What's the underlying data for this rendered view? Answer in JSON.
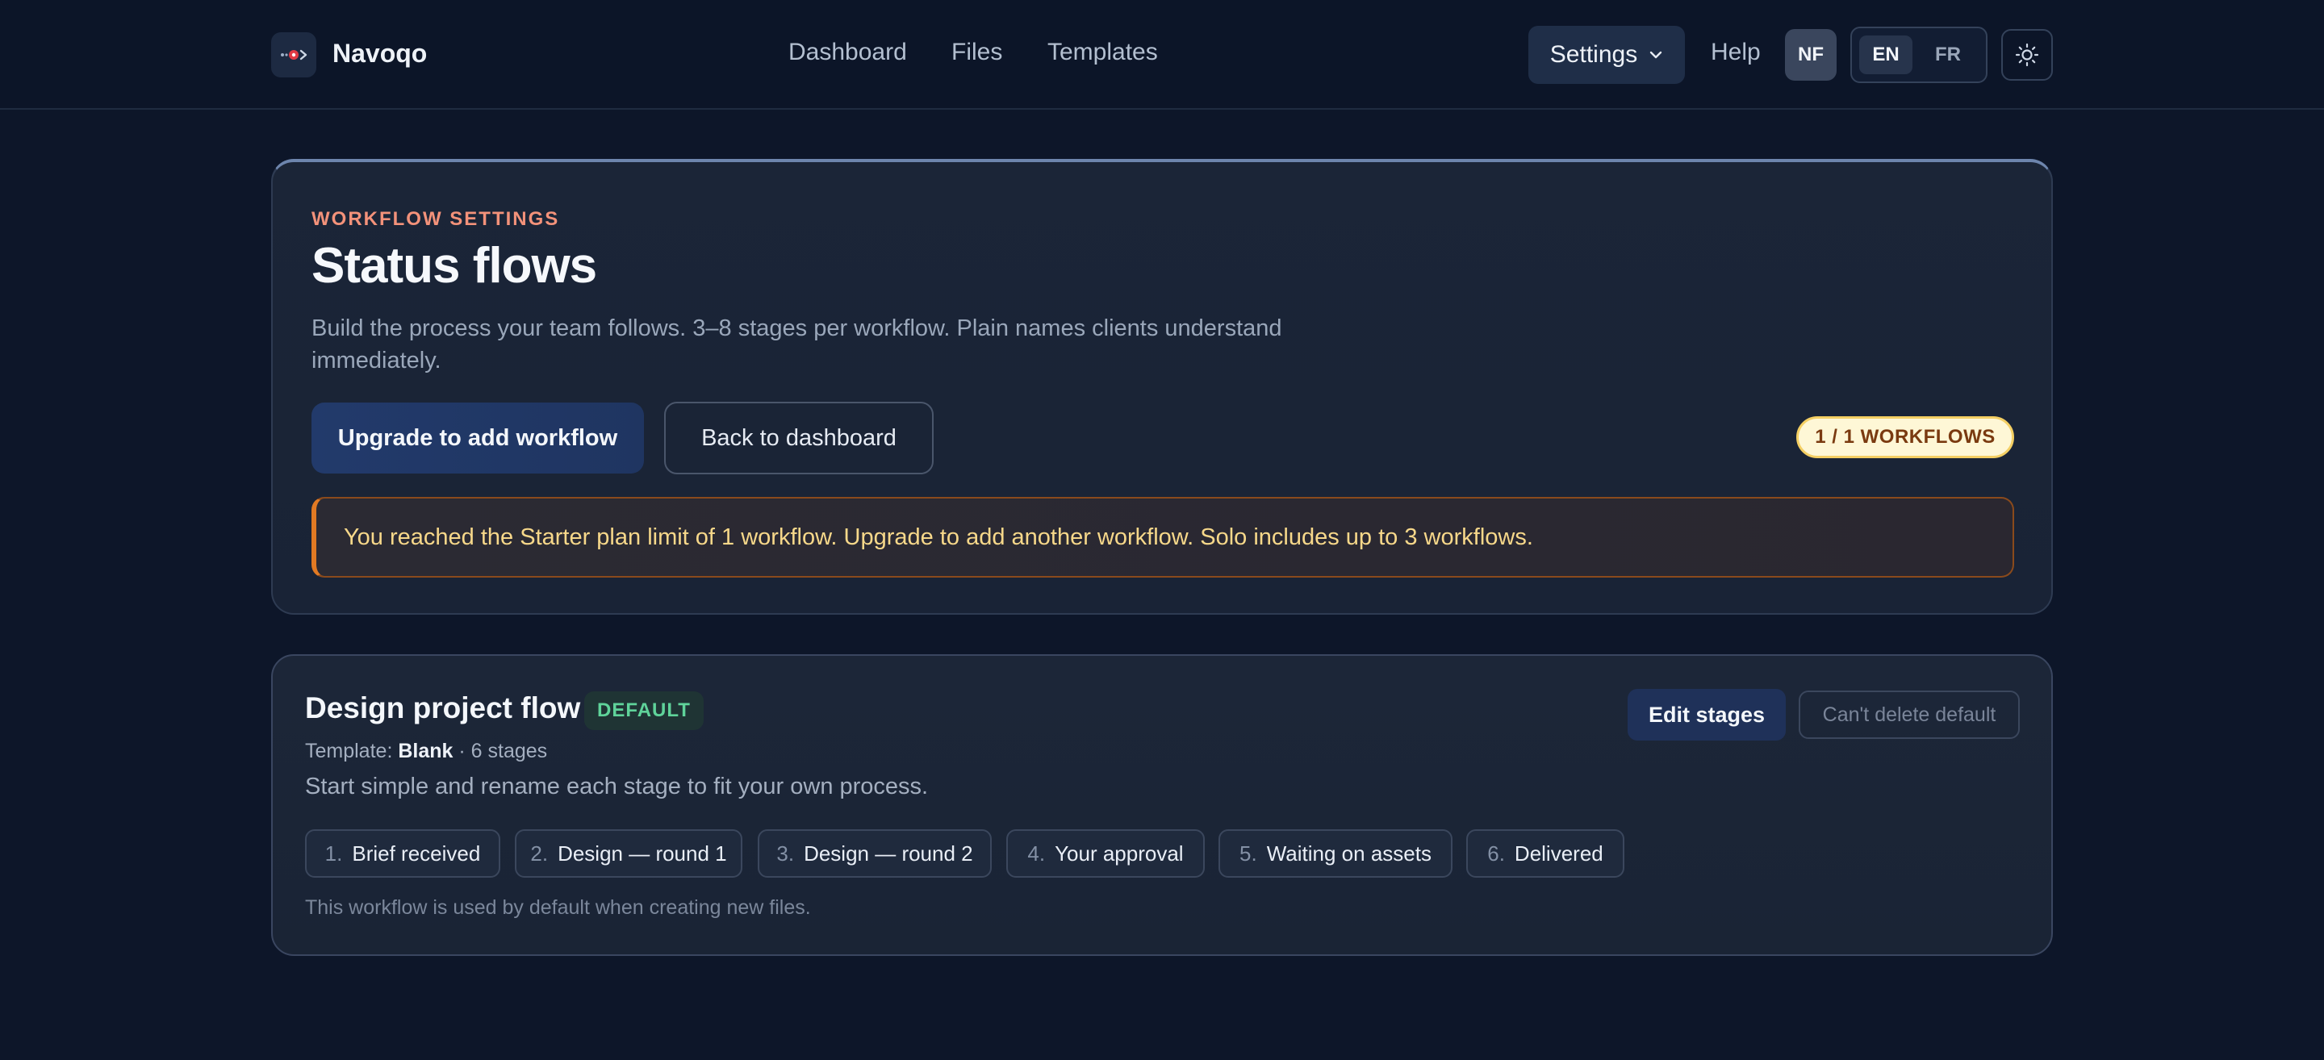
{
  "header": {
    "brand": "Navoqo",
    "nav": [
      "Dashboard",
      "Files",
      "Templates"
    ],
    "settings_label": "Settings",
    "help_label": "Help",
    "avatar_initials": "NF",
    "languages": [
      "EN",
      "FR"
    ],
    "active_language": "EN",
    "icons": {
      "logo": "navoqo-logo-icon",
      "dropdown": "chevron-down-icon",
      "theme": "sun-icon"
    }
  },
  "page": {
    "eyebrow": "WORKFLOW SETTINGS",
    "title": "Status flows",
    "subtitle": "Build the process your team follows. 3–8 stages per workflow. Plain names clients understand immediately.",
    "upgrade_button": "Upgrade to add workflow",
    "back_button": "Back to dashboard",
    "workflow_count": "1 / 1 WORKFLOWS",
    "alert": "You reached the Starter plan limit of 1 workflow. Upgrade to add another workflow. Solo includes up to 3 workflows."
  },
  "workflow": {
    "name": "Design project flow",
    "badge": "DEFAULT",
    "template_label": "Template:",
    "template_name": "Blank",
    "stage_count": "· 6 stages",
    "description": "Start simple and rename each stage to fit your own process.",
    "edit_button": "Edit stages",
    "delete_button": "Can't delete default",
    "stages": [
      {
        "num": "1.",
        "label": "Brief received"
      },
      {
        "num": "2.",
        "label": "Design — round 1"
      },
      {
        "num": "3.",
        "label": "Design — round 2"
      },
      {
        "num": "4.",
        "label": "Your approval"
      },
      {
        "num": "5.",
        "label": "Waiting on assets"
      },
      {
        "num": "6.",
        "label": "Delivered"
      }
    ],
    "footnote": "This workflow is used by default when creating new files."
  },
  "colors": {
    "background": "#0d1629",
    "accent_eyebrow": "#f3927a",
    "alert_border": "#e27a23",
    "alert_text": "#f7d88a",
    "badge_bg": "#fef7d6",
    "default_badge_text": "#5fd39a"
  }
}
